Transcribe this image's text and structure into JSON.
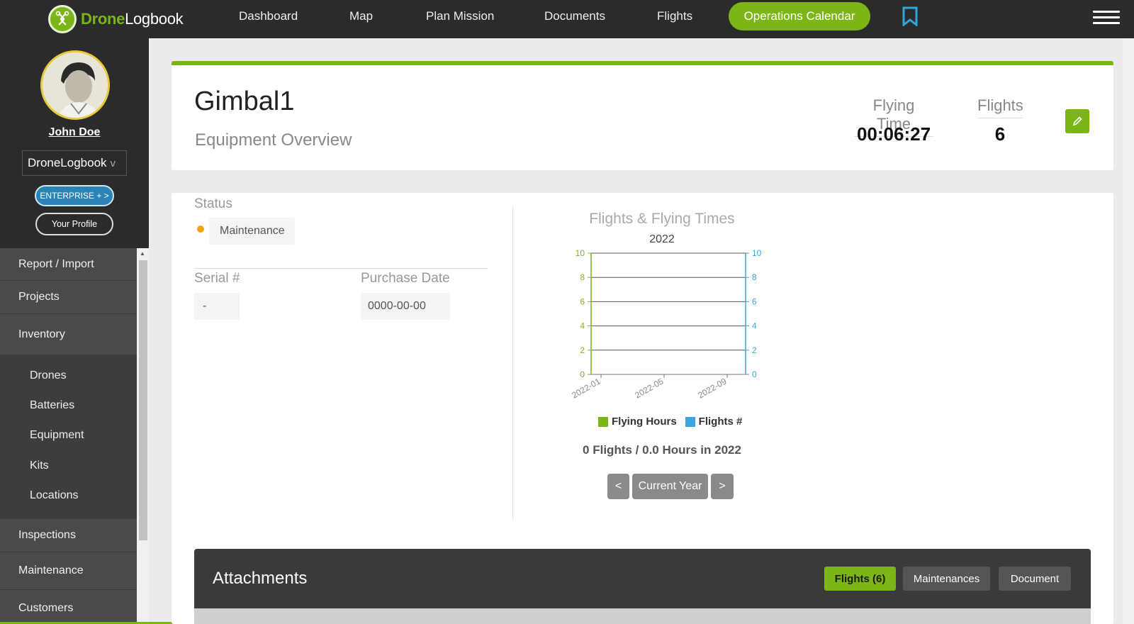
{
  "app": {
    "brand_part1": "Drone",
    "brand_part2": "Logbook",
    "accent": "#7cb518",
    "nav_bg": "#2b2b2b"
  },
  "nav": {
    "items": [
      "Dashboard",
      "Map",
      "Plan Mission",
      "Documents",
      "Flights"
    ],
    "cta": "Operations Calendar",
    "icons": [
      "bookmark-icon",
      "hamburger-menu-icon"
    ]
  },
  "sidebar": {
    "user_name": "John Doe",
    "org": "DroneLogbook",
    "org_chevron": "v",
    "enterprise_label": "ENTERPRISE + >",
    "profile_label": "Your Profile",
    "menu": [
      "Report / Import",
      "Projects",
      "Inventory",
      "Inspections",
      "Maintenance",
      "Customers"
    ],
    "inventory_sub": [
      "Drones",
      "Batteries",
      "Equipment",
      "Kits",
      "Locations"
    ]
  },
  "header": {
    "title": "Gimbal1",
    "subtitle": "Equipment Overview",
    "flying_time_label": "Flying Time",
    "flying_time": "00:06:27",
    "flights_label": "Flights",
    "flights": "6"
  },
  "overview": {
    "status_label": "Status",
    "status_value": "Maintenance",
    "status_color": "#f0a30a",
    "serial_label": "Serial #",
    "serial_value": "-",
    "purchase_label": "Purchase Date",
    "purchase_value": "0000-00-00"
  },
  "chart_data": {
    "type": "line",
    "title": "Flights & Flying Times",
    "subtitle": "2022",
    "x_tick_labels": [
      "2022-01",
      "2022-05",
      "2022-09"
    ],
    "series": [
      {
        "name": "Flying Hours",
        "color": "#7cb518",
        "values": [
          0,
          0,
          0
        ]
      },
      {
        "name": "Flights #",
        "color": "#3ba6d9",
        "values": [
          0,
          0,
          0
        ]
      }
    ],
    "y_left_ticks": [
      0,
      2,
      4,
      6,
      8,
      10
    ],
    "y_right_ticks": [
      0,
      2,
      4,
      6,
      8,
      10
    ],
    "ylim": [
      0,
      10
    ],
    "grid": true,
    "summary": "0 Flights / 0.0 Hours in 2022"
  },
  "pager": {
    "prev": "<",
    "current": "Current Year",
    "next": ">"
  },
  "attachments": {
    "title": "Attachments",
    "tabs": [
      "Flights (6)",
      "Maintenances",
      "Document"
    ]
  }
}
